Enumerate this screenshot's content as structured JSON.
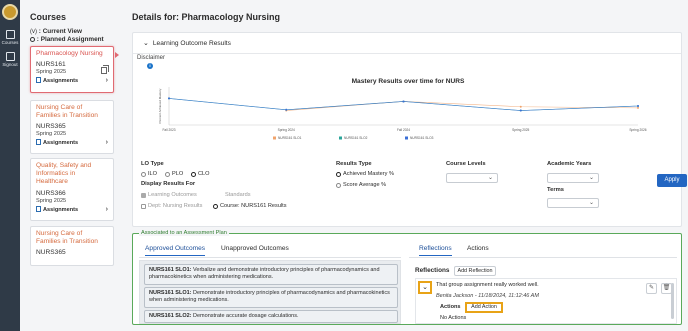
{
  "rail": {
    "items": [
      {
        "label": "Courses",
        "icon": "book-icon"
      },
      {
        "label": "Signout",
        "icon": "signout-icon"
      }
    ]
  },
  "courses": {
    "title": "Courses",
    "view_label": "Current View",
    "view_key": "(v)",
    "planned_label": "Planned Assignment",
    "list": [
      {
        "name": "Pharmacology Nursing",
        "code": "NURS161",
        "term": "Spring 2025",
        "link": "Assignments",
        "active": true
      },
      {
        "name": "Nursing Care of Families in Transition",
        "code": "NURS365",
        "term": "Spring 2025",
        "link": "Assignments",
        "active": false
      },
      {
        "name": "Quality, Safety and Informatics in Healthcare",
        "code": "NURS366",
        "term": "Spring 2025",
        "link": "Assignments",
        "active": false
      },
      {
        "name": "Nursing Care of Families in Transition",
        "code": "NURS365",
        "term": "",
        "link": "",
        "active": false
      }
    ]
  },
  "details": {
    "title": "Details for: Pharmacology Nursing",
    "panel_title": "Learning Outcome Results",
    "disclaimer": "Disclaimer",
    "chart_title": "Mastery Results over time for NURS"
  },
  "chart_data": {
    "type": "line",
    "title": "Mastery Results over time for NURS",
    "ylabel": "Percent Achieved Mastery",
    "categories": [
      "Fall 2023",
      "Spring 2024",
      "Fall 2024",
      "Spring 2025",
      "Spring 2026"
    ],
    "ylim": [
      0,
      100
    ],
    "series": [
      {
        "name": "NURS161 SLO1",
        "color": "#f0a36b",
        "values": [
          null,
          38,
          62,
          48,
          45
        ]
      },
      {
        "name": "NURS161 SLO2",
        "color": "#2aa59a",
        "values": [
          70,
          40,
          62,
          38,
          50
        ]
      },
      {
        "name": "NURS161 SLO3",
        "color": "#3b6fd6",
        "values": [
          70,
          40,
          62,
          38,
          50
        ]
      }
    ],
    "legend": "bottom"
  },
  "filters": {
    "lo_type_label": "LO Type",
    "lo_types": [
      "ILO",
      "PLO",
      "CLO"
    ],
    "lo_selected": "CLO",
    "display_label": "Display Results For",
    "learning_outcomes": "Learning Outcomes",
    "standards": "Standards",
    "dept": "Dept: Nursing Results",
    "course": "Course: NURS161 Results",
    "results_type_label": "Results Type",
    "achieved": "Achieved Mastery %",
    "score_avg": "Score Average %",
    "course_levels_label": "Course Levels",
    "academic_years_label": "Academic Years",
    "terms_label": "Terms",
    "apply": "Apply"
  },
  "plan": {
    "legend": "Associated to an Assessment Plan",
    "tab_approved": "Approved Outcomes",
    "tab_unapproved": "Unapproved Outcomes",
    "outcomes": [
      {
        "code": "NURS161 SLO1:",
        "text": "Verbalize and demonstrate introductory principles of pharmacodynamics and pharmacokinetics when administering medications."
      },
      {
        "code": "NURS161 SLO1:",
        "text": "Demonstrate introductory principles of pharmacodynamics and pharmacokinetics when administering medications."
      },
      {
        "code": "NURS161 SLO2:",
        "text": "Demonstrate accurate dosage calculations."
      }
    ],
    "tab_reflections": "Reflections",
    "tab_actions": "Actions",
    "reflections_heading": "Reflections",
    "add_reflection": "Add Reflection",
    "reflection_text": "That group assignment really worked well.",
    "reflection_meta": "Benita Jackson - 11/18/2024, 11:12:46 AM",
    "actions_label": "Actions",
    "add_action": "Add Action",
    "no_actions": "No Actions"
  }
}
